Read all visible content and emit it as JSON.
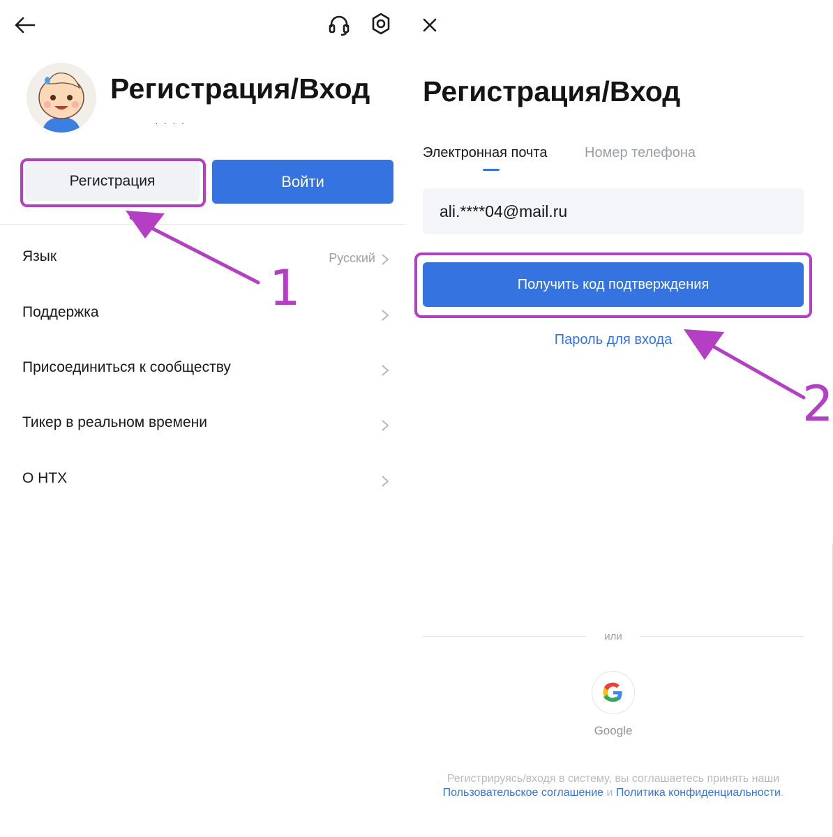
{
  "left": {
    "title": "Регистрация/Вход",
    "subtitle": "· ·              · ·",
    "buttons": {
      "register": "Регистрация",
      "login": "Войти"
    },
    "menu": [
      {
        "label": "Язык",
        "value": "Русский"
      },
      {
        "label": "Поддержка",
        "value": ""
      },
      {
        "label": "Присоединиться к сообществу",
        "value": ""
      },
      {
        "label": "Тикер в реальном времени",
        "value": ""
      },
      {
        "label": "О HTX",
        "value": ""
      }
    ],
    "annotation": "1"
  },
  "right": {
    "title": "Регистрация/Вход",
    "tabs": {
      "email": "Электронная почта",
      "phone": "Номер телефона"
    },
    "email_value": "ali.****04@mail.ru",
    "get_code_button": "Получить код подтверждения",
    "password_link": "Пароль для входа",
    "or": "или",
    "google": "Google",
    "terms": {
      "text": "Регистрируясь/входя в систему, вы соглашаетесь принять наши",
      "user_agreement": "Пользовательское соглашение",
      "and": " и ",
      "privacy": "Политика конфиденциальности",
      "end": "."
    },
    "annotation": "2"
  },
  "colors": {
    "accent": "#3473e0",
    "highlight": "#b43fc4"
  },
  "icons": [
    "back-arrow-icon",
    "headset-icon",
    "settings-gear-icon",
    "close-icon",
    "chevron-right-icon",
    "google-g-icon"
  ]
}
